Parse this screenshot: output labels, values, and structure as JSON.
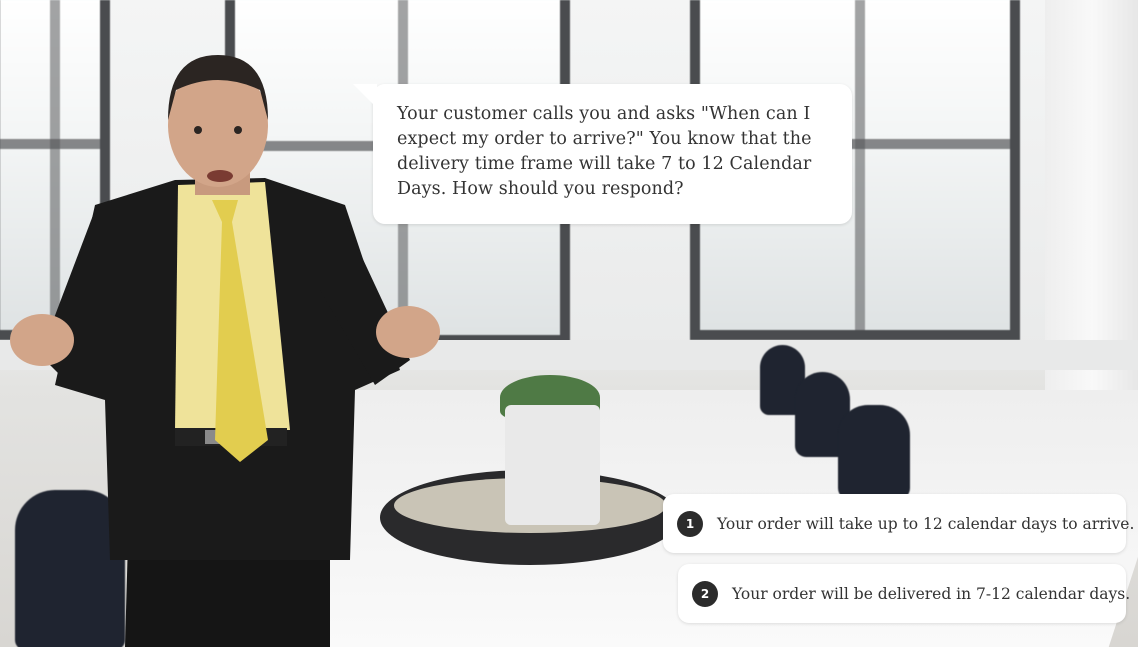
{
  "scenario": {
    "prompt": "Your customer calls you and asks \"When can I expect my order to arrive?\" You know that the delivery time frame will take 7 to 12 Calendar Days. How should you respond?"
  },
  "options": [
    {
      "number": "1",
      "label": "Your order will take up to 12 calendar days to arrive."
    },
    {
      "number": "2",
      "label": "Your order will be delivered in 7-12 calendar days."
    }
  ]
}
